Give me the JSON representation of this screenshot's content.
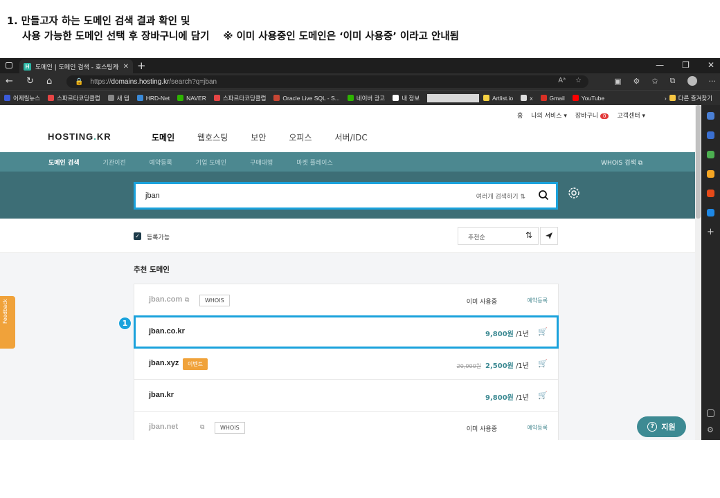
{
  "instructions": {
    "line1": "1. 만들고자 하는 도메인 검색 결과 확인 및",
    "line2": "사용 가능한 도메인 선택 후 장바구니에 담기",
    "note": "※ 이미 사용중인 도메인은 ‘이미 사용중’ 이라고 안내됨"
  },
  "browser": {
    "tab_title": "도메인 | 도메인 검색 - 호스팅케이",
    "url_prefix": "https://",
    "url_host": "domains.hosting.kr",
    "url_path": "/search?q=jban",
    "bookmarks": [
      {
        "label": "어제릴뉴스",
        "color": "#3b5bdb"
      },
      {
        "label": "스파르타코딩클럽",
        "color": "#e64545"
      },
      {
        "label": "새 탭",
        "color": "#888888"
      },
      {
        "label": "HRD-Net",
        "color": "#3a8ad8"
      },
      {
        "label": "NAVER",
        "color": "#2db400"
      },
      {
        "label": "스파르타코딩클럽",
        "color": "#e64545"
      },
      {
        "label": "Oracle Live SQL - S...",
        "color": "#c74634"
      },
      {
        "label": "네이버 광고",
        "color": "#2db400"
      },
      {
        "label": "내 정보",
        "color": "#ffffff"
      },
      {
        "label": "Artlist.io",
        "color": "#f5d142"
      },
      {
        "label": "x",
        "color": "#dddddd"
      },
      {
        "label": "Gmail",
        "color": "#d93025"
      },
      {
        "label": "YouTube",
        "color": "#ff0000"
      }
    ],
    "other_bookmarks": "다른 즐겨찾기"
  },
  "site": {
    "util": {
      "home": "홈",
      "my_service": "나의 서비스",
      "cart": "장바구니",
      "cart_count": "0",
      "support": "고객센터"
    },
    "logo": "HOSTING",
    "logo_dot": ".",
    "logo_tail": "KR",
    "gnb": [
      "도메인",
      "웹호스팅",
      "보안",
      "오피스",
      "서버/IDC"
    ],
    "subnav": [
      "도메인 검색",
      "기관이전",
      "예약등록",
      "기업 도메인",
      "구매대행",
      "마켓 플레이스"
    ],
    "subnav_whois": "WHOIS 검색",
    "search": {
      "query": "jban",
      "multi_label": "여러개 검색하기"
    },
    "filter_label": "등록가능",
    "sort_label": "추천순",
    "rec_title": "추천 도메인",
    "domains": [
      {
        "name": "jban.com",
        "status": "이미 사용중",
        "reserve": "예약등록",
        "whois": "WHOIS"
      },
      {
        "name": "jban.co.kr",
        "price": "9,800원",
        "period": "/1년"
      },
      {
        "name": "jban.xyz",
        "event": "이벤트",
        "old_price": "20,000원",
        "price": "2,500원",
        "period": "/1년"
      },
      {
        "name": "jban.kr",
        "price": "9,800원",
        "period": "/1년"
      },
      {
        "name": "jban.net",
        "status": "이미 사용중",
        "reserve": "예약등록",
        "whois": "WHOIS"
      }
    ],
    "marker": "1",
    "feedback": "Feedback",
    "support_btn": "지원"
  },
  "colors": {
    "accent": "#1aa2dc",
    "teal": "#3d6e76",
    "subnav": "#4c8890",
    "price": "#3d8a93",
    "event": "#f0a23a"
  }
}
